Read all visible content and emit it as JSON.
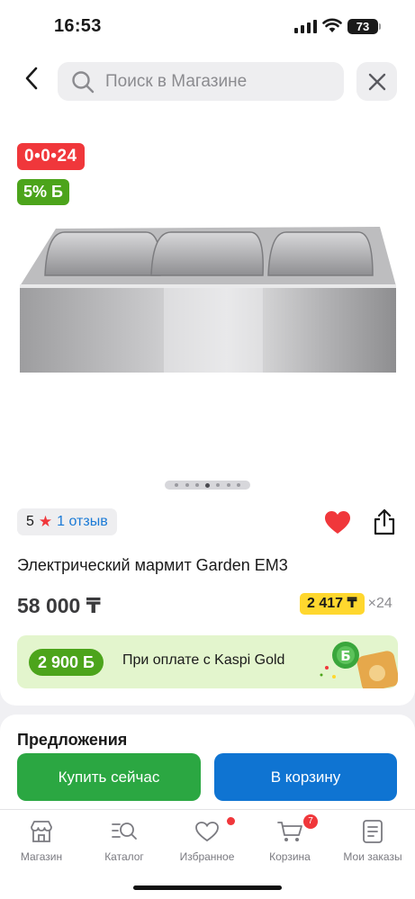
{
  "status": {
    "time": "16:53",
    "battery": "73"
  },
  "search": {
    "placeholder": "Поиск в Магазине"
  },
  "product": {
    "timer_badge": "0•0•24",
    "bonus_badge": "5% Б",
    "rating": "5",
    "reviews": "1 отзыв",
    "title": "Электрический мармит Garden EM3",
    "price": "58 000 ₸",
    "installment": "2 417 ₸",
    "installment_multiplier": "×24",
    "gallery_images": 7,
    "gallery_active": 3
  },
  "kaspi_gold": {
    "bonus": "2 900 Б",
    "text": "При оплате с Kaspi Gold"
  },
  "offers": {
    "title": "Предложения"
  },
  "actions": {
    "buy_now": "Купить сейчас",
    "add_to_cart": "В корзину"
  },
  "tabs": [
    {
      "label": "Магазин",
      "icon": "store-icon"
    },
    {
      "label": "Каталог",
      "icon": "catalog-icon"
    },
    {
      "label": "Избранное",
      "icon": "heart-outline-icon"
    },
    {
      "label": "Корзина",
      "icon": "cart-icon",
      "badge": "7"
    },
    {
      "label": "Мои заказы",
      "icon": "orders-icon"
    }
  ],
  "colors": {
    "red": "#f0373b",
    "green": "#4ca41b",
    "buy_green": "#2ba742",
    "blue": "#0f74d2",
    "yellow": "#ffd72e"
  }
}
